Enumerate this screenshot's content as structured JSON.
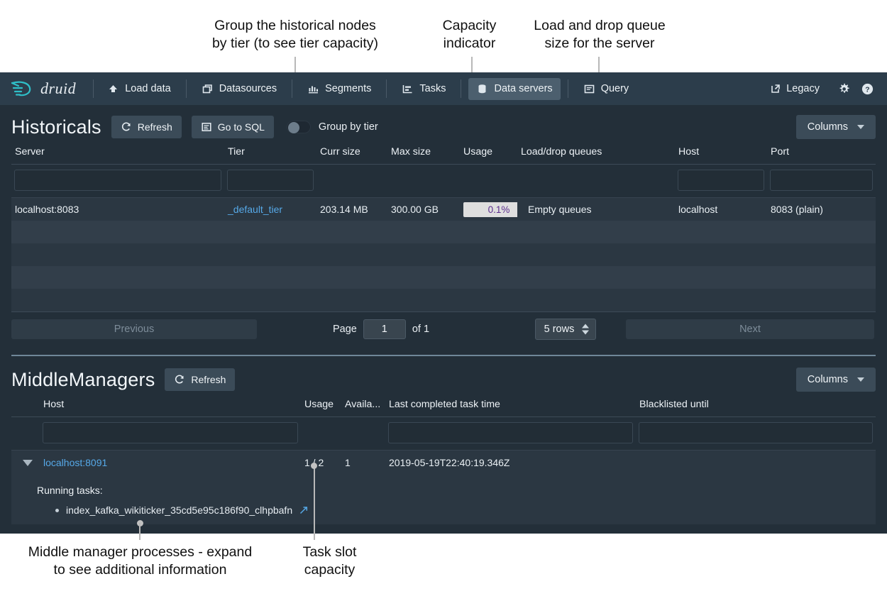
{
  "annotations": [
    {
      "id": "group-by-tier",
      "text": "Group the historical nodes\nby tier (to see tier capacity)"
    },
    {
      "id": "capacity-indicator",
      "text": "Capacity\nindicator"
    },
    {
      "id": "load-drop-queue",
      "text": "Load and drop queue\nsize for the server"
    },
    {
      "id": "middle-manager-processes",
      "text": "Middle manager processes - expand\nto see additional information"
    },
    {
      "id": "task-slot-capacity",
      "text": "Task slot\ncapacity"
    }
  ],
  "navbar": {
    "brand": "druid",
    "items": [
      {
        "label": "Load data",
        "icon": "upload-icon",
        "active": false
      },
      {
        "label": "Datasources",
        "icon": "stack-icon",
        "active": false
      },
      {
        "label": "Segments",
        "icon": "segments-icon",
        "active": false
      },
      {
        "label": "Tasks",
        "icon": "tasks-icon",
        "active": false
      },
      {
        "label": "Data servers",
        "icon": "database-icon",
        "active": true
      },
      {
        "label": "Query",
        "icon": "query-icon",
        "active": false
      }
    ],
    "right": {
      "legacy_label": "Legacy",
      "legacy_icon": "external-link-icon",
      "settings_icon": "gear-icon",
      "help_icon": "help-icon"
    }
  },
  "historicals": {
    "title": "Historicals",
    "refresh_label": "Refresh",
    "refresh_icon": "refresh-icon",
    "go_to_sql_label": "Go to SQL",
    "go_to_sql_icon": "sql-icon",
    "group_by_tier_label": "Group by tier",
    "group_by_tier_on": false,
    "columns_label": "Columns",
    "headers": [
      "Server",
      "Tier",
      "Curr size",
      "Max size",
      "Usage",
      "Load/drop queues",
      "Host",
      "Port"
    ],
    "filters": [
      {
        "column": "Server",
        "value": "",
        "enabled": true
      },
      {
        "column": "Tier",
        "value": "",
        "enabled": true
      },
      {
        "column": "Curr size",
        "value": "",
        "enabled": false
      },
      {
        "column": "Max size",
        "value": "",
        "enabled": false
      },
      {
        "column": "Usage",
        "value": "",
        "enabled": false
      },
      {
        "column": "Load/drop queues",
        "value": "",
        "enabled": false
      },
      {
        "column": "Host",
        "value": "",
        "enabled": true
      },
      {
        "column": "Port",
        "value": "",
        "enabled": true
      }
    ],
    "rows": [
      {
        "server": "localhost:8083",
        "tier": "_default_tier",
        "curr_size": "203.14 MB",
        "max_size": "300.00 GB",
        "usage": "0.1%",
        "usage_percent": 0.1,
        "load_drop_queues": "Empty queues",
        "host": "localhost",
        "port": "8083 (plain)"
      }
    ],
    "empty_row_count": 4,
    "pagination": {
      "previous_label": "Previous",
      "next_label": "Next",
      "page_label": "Page",
      "page_value": "1",
      "of_label": "of 1",
      "rows_per_page": "5 rows"
    }
  },
  "middlemanagers": {
    "title": "MiddleManagers",
    "refresh_label": "Refresh",
    "refresh_icon": "refresh-icon",
    "columns_label": "Columns",
    "headers": [
      "",
      "Host",
      "Usage",
      "Availa...",
      "Last completed task time",
      "Blacklisted until"
    ],
    "filters": [
      {
        "column": "Host",
        "value": "",
        "enabled": true
      },
      {
        "column": "Usage",
        "value": "",
        "enabled": false
      },
      {
        "column": "Availa...",
        "value": "",
        "enabled": false
      },
      {
        "column": "Last completed task time",
        "value": "",
        "enabled": true
      },
      {
        "column": "Blacklisted until",
        "value": "",
        "enabled": true
      }
    ],
    "rows": [
      {
        "expanded": true,
        "host": "localhost:8091",
        "usage": "1 / 2",
        "available": "1",
        "last_completed_task_time": "2019-05-19T22:40:19.346Z",
        "blacklisted_until": ""
      }
    ],
    "expanded_detail": {
      "running_tasks_label": "Running tasks:",
      "tasks": [
        {
          "name": "index_kafka_wikiticker_35cd5e95c186f90_clhpbafn",
          "icon": "external-link-icon"
        }
      ]
    }
  },
  "colors": {
    "navbar_bg": "#2c3d4b",
    "page_bg": "#232f39",
    "row_dark": "#2b3742",
    "row_light": "#323e4a",
    "link": "#56a9e8",
    "usage_pill_bg": "#dedede",
    "usage_pill_text": "#5b2d8e",
    "divider": "#6f8799",
    "brand_accent": "#2fbfc8"
  }
}
